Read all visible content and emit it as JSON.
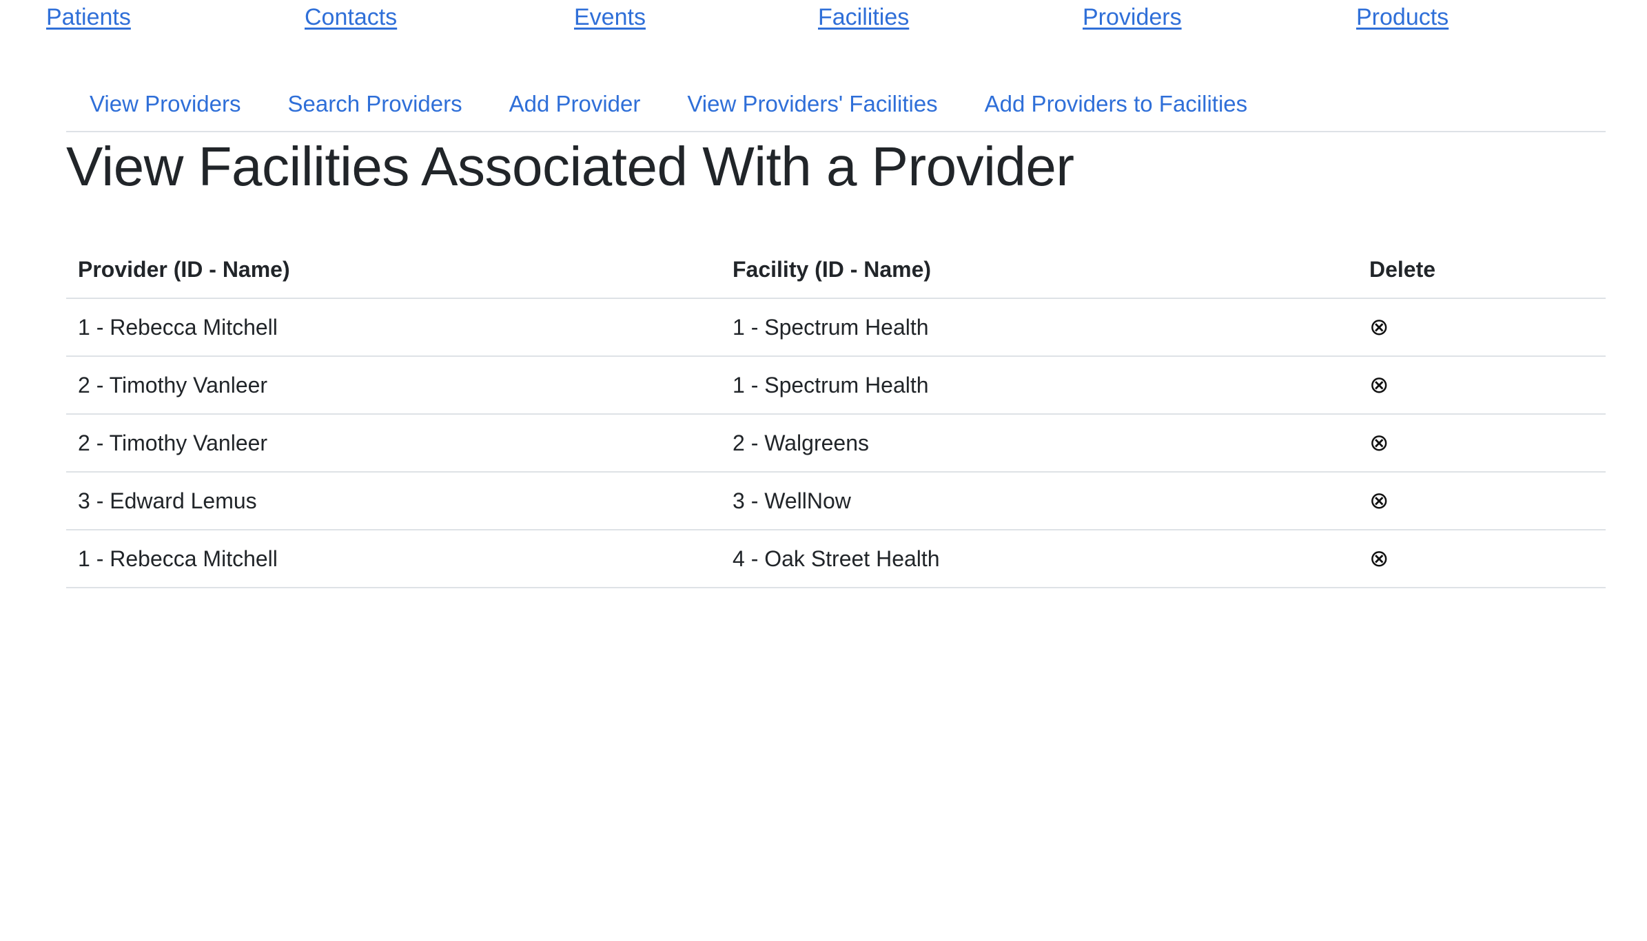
{
  "top_nav": {
    "items": [
      "Patients",
      "Contacts",
      "Events",
      "Facilities",
      "Providers",
      "Products"
    ]
  },
  "sub_nav": {
    "items": [
      "View Providers",
      "Search Providers",
      "Add Provider",
      "View Providers' Facilities",
      "Add Providers to Facilities"
    ]
  },
  "page": {
    "title": "View Facilities Associated With a Provider"
  },
  "table": {
    "headers": {
      "provider": "Provider (ID - Name)",
      "facility": "Facility (ID - Name)",
      "delete": "Delete"
    },
    "delete_icon": "⊗",
    "rows": [
      {
        "provider": "1 - Rebecca Mitchell",
        "facility": "1 - Spectrum Health"
      },
      {
        "provider": "2 - Timothy Vanleer",
        "facility": "1 - Spectrum Health"
      },
      {
        "provider": "2 - Timothy Vanleer",
        "facility": "2 - Walgreens"
      },
      {
        "provider": "3 - Edward Lemus",
        "facility": "3 - WellNow"
      },
      {
        "provider": "1 - Rebecca Mitchell",
        "facility": "4 - Oak Street Health"
      }
    ]
  },
  "colors": {
    "link": "#2f6fd8",
    "text": "#212529",
    "border": "#dee2e6"
  }
}
